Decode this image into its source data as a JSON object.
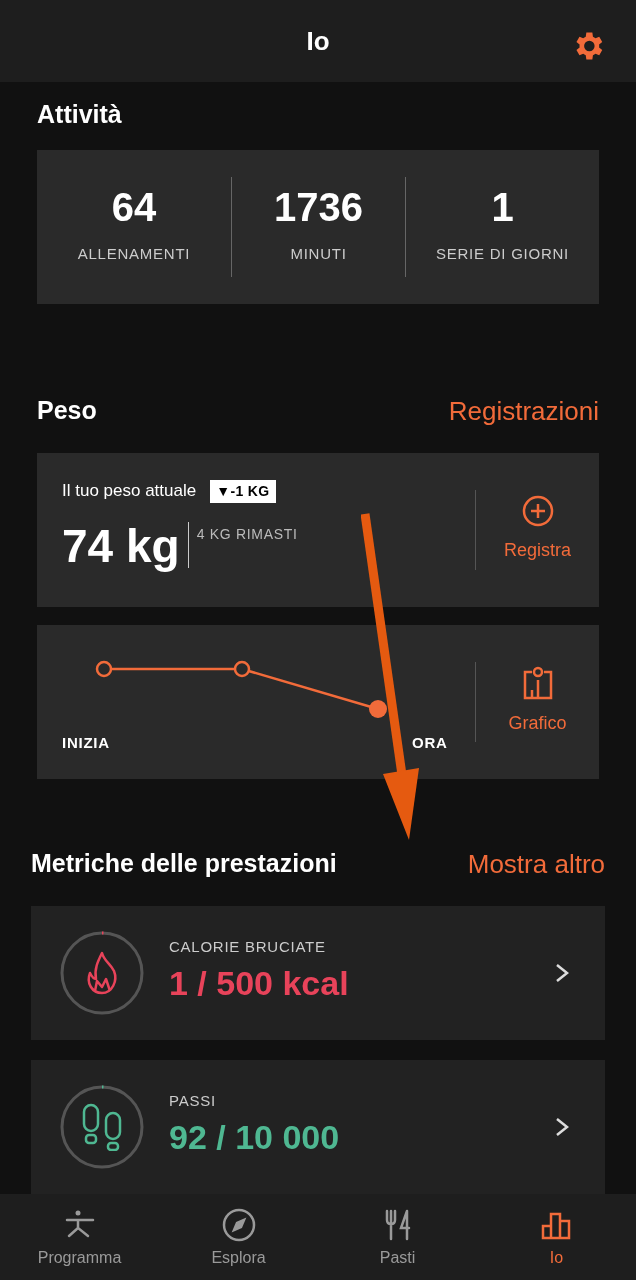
{
  "header": {
    "title": "Io"
  },
  "activity": {
    "title": "Attività",
    "stats": [
      {
        "value": "64",
        "label": "ALLENAMENTI"
      },
      {
        "value": "1736",
        "label": "MINUTI"
      },
      {
        "value": "1",
        "label": "SERIE DI GIORNI"
      }
    ]
  },
  "weight": {
    "title": "Peso",
    "link": "Registrazioni",
    "current_label": "Il tuo peso attuale",
    "change_badge": "▼-1 KG",
    "value": "74 kg",
    "remaining": "4 KG RIMASTI",
    "log_button": "Registra",
    "start_label": "INIZIA",
    "now_label": "ORA",
    "chart_button": "Grafico"
  },
  "metrics": {
    "title": "Metriche delle prestazioni",
    "link": "Mostra altro",
    "items": [
      {
        "kind": "calories",
        "label": "CALORIE BRUCIATE",
        "value": "1 / 500 kcal",
        "color": "#e8435a"
      },
      {
        "kind": "steps",
        "label": "PASSI",
        "value": "92 / 10 000",
        "color": "#4fb892"
      }
    ]
  },
  "tabs": [
    {
      "kind": "program",
      "label": "Programma",
      "selected": false
    },
    {
      "kind": "explore",
      "label": "Esplora",
      "selected": false
    },
    {
      "kind": "meals",
      "label": "Pasti",
      "selected": false
    },
    {
      "kind": "me",
      "label": "Io",
      "selected": true
    }
  ]
}
